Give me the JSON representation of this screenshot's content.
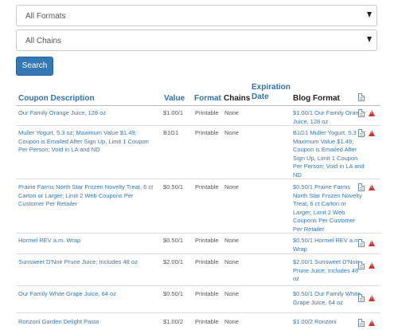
{
  "filters": {
    "formats": {
      "selected": "All Formats"
    },
    "chains": {
      "selected": "All Chains"
    },
    "search_label": "Search"
  },
  "table": {
    "headers": {
      "description": "Coupon Description",
      "value": "Value",
      "format": "Format",
      "chains": "Chains",
      "expiration_line1": "Expiration",
      "expiration_line2": "Date",
      "blog": "Blog Format"
    },
    "rows": [
      {
        "description": "Our Family Orange Juice, 128 oz",
        "value": "$1.00/1",
        "format": "Printable",
        "chains": "None",
        "blog": "$1.00/1 Our Family Orange Juice, 128 oz"
      },
      {
        "description": "Muller Yogurt, 5.3 oz; Maximum Value $1.49; Coupon is Emailed After Sign Up, Limit 1 Coupon Per Person; Void in LA and ND",
        "value": "B1G1",
        "format": "Printable",
        "chains": "None",
        "blog": "B1G1 Muller Yogurt, 5.3 oz; Maximum Value $1.49; Coupon is Emailed After Sign Up, Limit 1 Coupon Per Person; Void in LA and ND"
      },
      {
        "description": "Prairie Farms North Star Frozen Novelty Treat, 6 ct Carton or Larger; Limit 2 Web Coupons Per Customer Per Retailer",
        "value": "$0.50/1",
        "format": "Printable",
        "chains": "None",
        "blog": "$0.50/1 Prairie Farms North Star Frozen Novelty Treat, 6 ct Carton or Larger; Limit 2 Web Coupons Per Customer Per Retailer"
      },
      {
        "description": "Hormel REV a.m. Wrap",
        "value": "$0.50/1",
        "format": "Printable",
        "chains": "None",
        "blog": "$0.50/1 Hormel REV a.m. Wrap"
      },
      {
        "description": "Sunsweet D'Noir Prune Juice; Includes 48 oz",
        "value": "$2.00/1",
        "format": "Printable",
        "chains": "None",
        "blog": "$2.00/1 Sunsweet D'Noir Prune Juice; Includes 48 oz"
      },
      {
        "description": "Our Family White Grape Juice, 64 oz",
        "value": "$0.50/1",
        "format": "Printable",
        "chains": "None",
        "blog": "$0.50/1 Our Family White Grape Juice, 64 oz"
      },
      {
        "description": "Ronzoni Garden Delight Pasta",
        "value": "$1.00/2",
        "format": "Printable",
        "chains": "None",
        "blog": "$1.00/2 Ronzoni"
      }
    ]
  }
}
